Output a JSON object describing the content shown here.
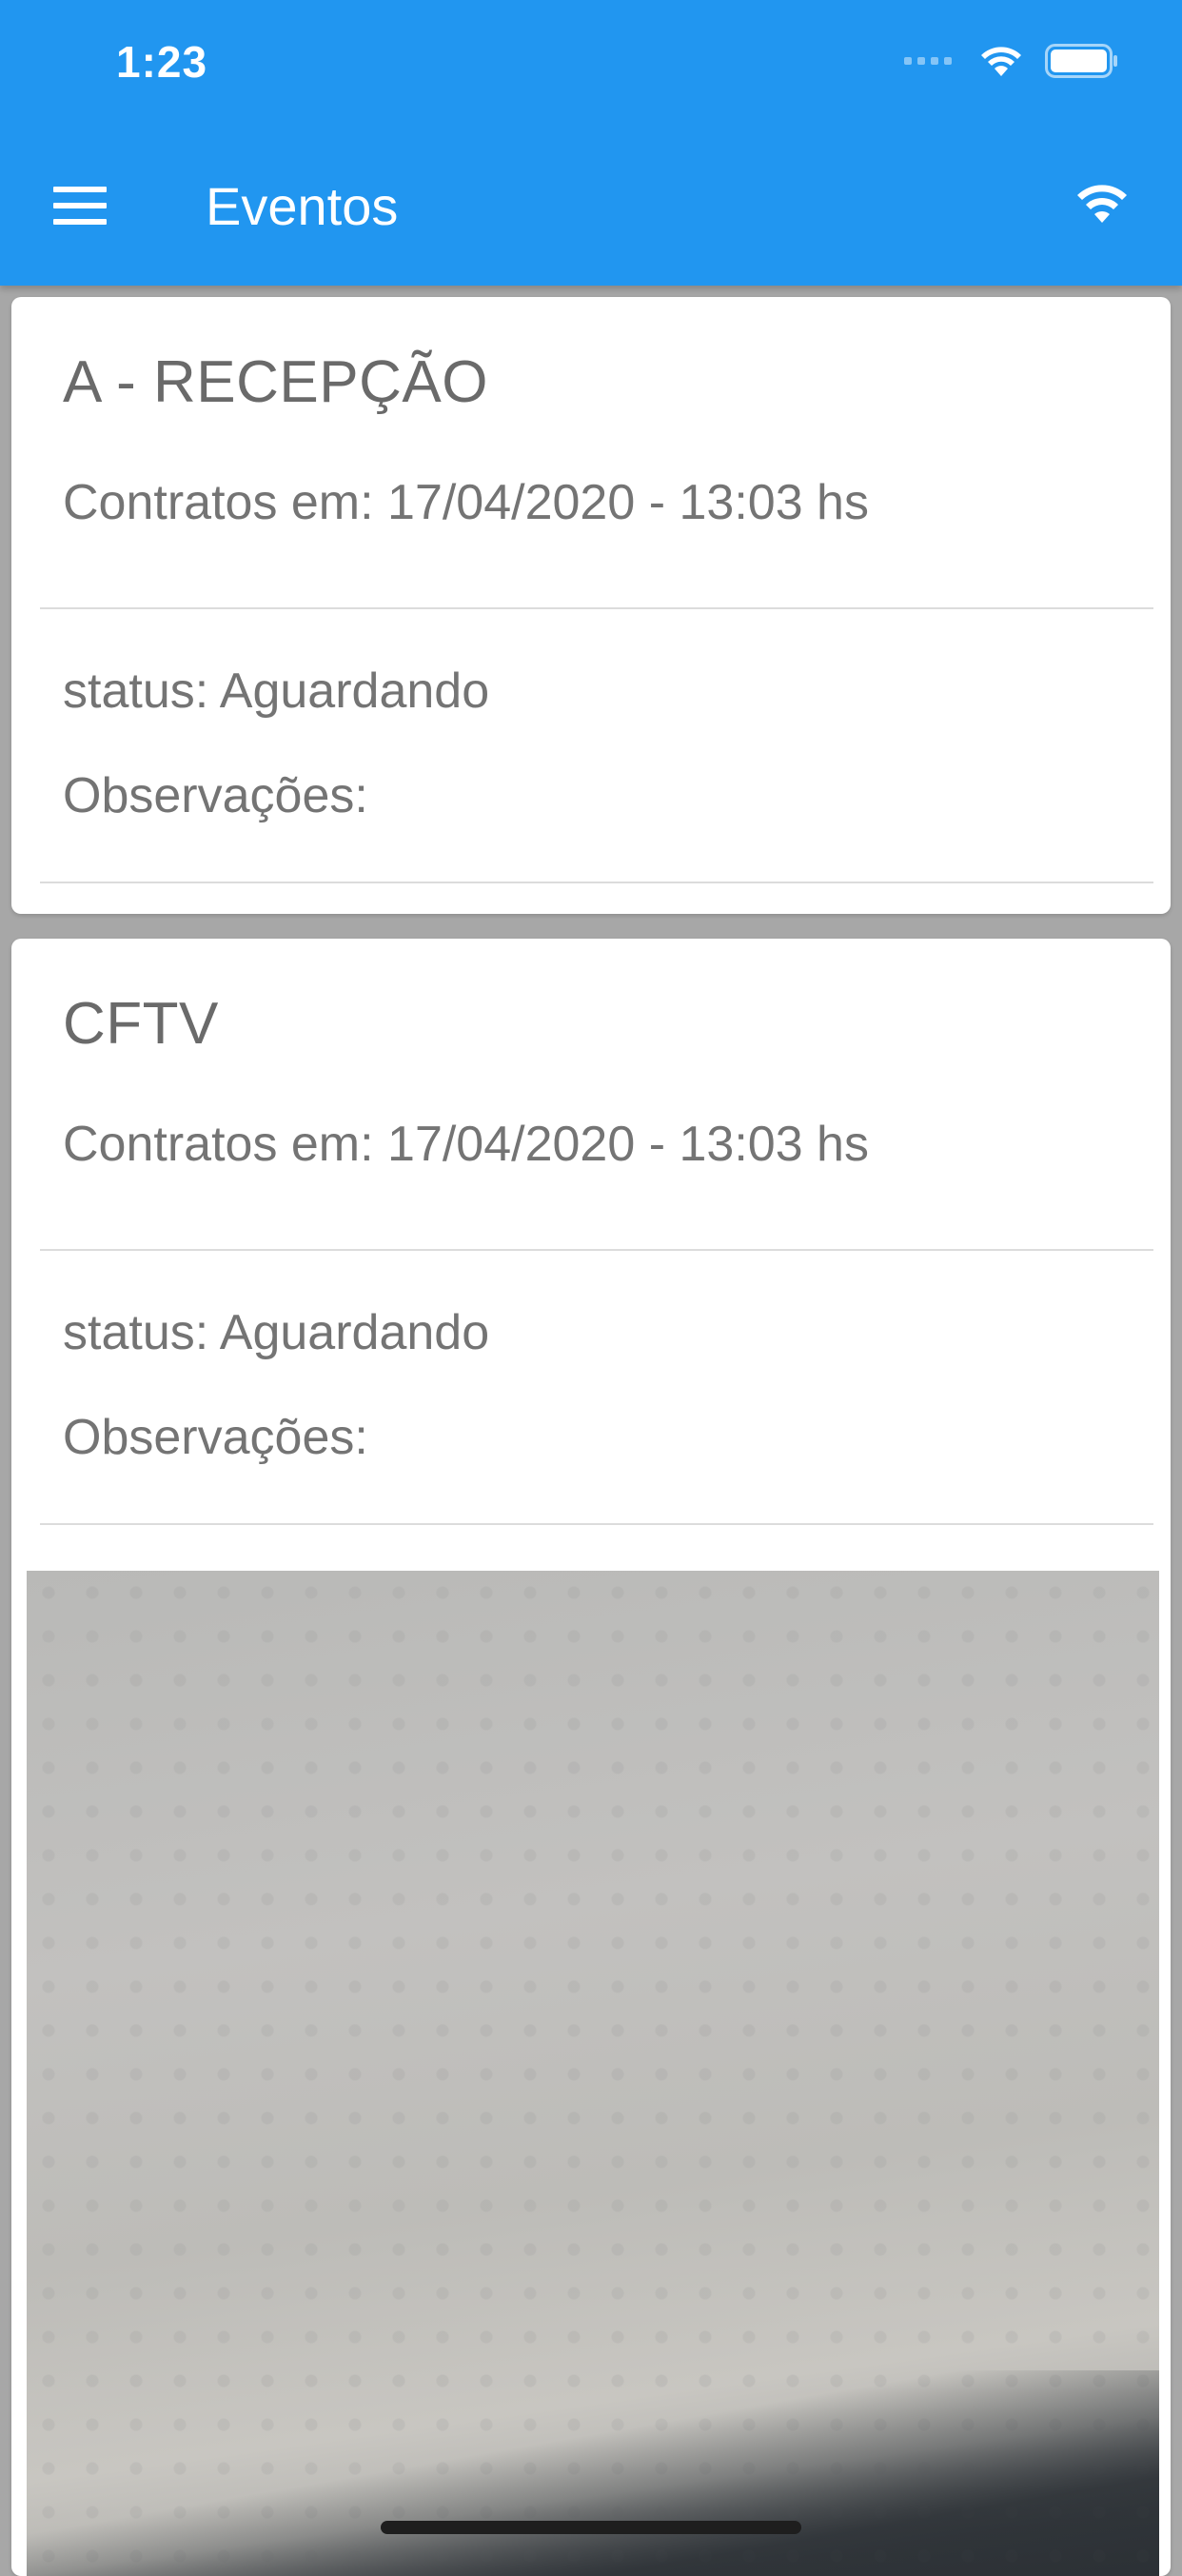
{
  "status_bar": {
    "time": "1:23",
    "icons": [
      "cellular-signal-icon",
      "wifi-icon",
      "battery-icon"
    ]
  },
  "header": {
    "title": "Eventos",
    "menu_icon": "menu-icon",
    "right_icon": "wifi-icon",
    "background_color": "#2196f0"
  },
  "events": [
    {
      "title": "A - RECEPÇÃO",
      "contracted": "Contratos em: 17/04/2020 - 13:03 hs",
      "status": "status: Aguardando",
      "notes": "Observações:"
    },
    {
      "title": "CFTV",
      "contracted": "Contratos em: 17/04/2020 - 13:03 hs",
      "status": "status: Aguardando",
      "notes": "Observações:",
      "has_photo": true
    }
  ]
}
